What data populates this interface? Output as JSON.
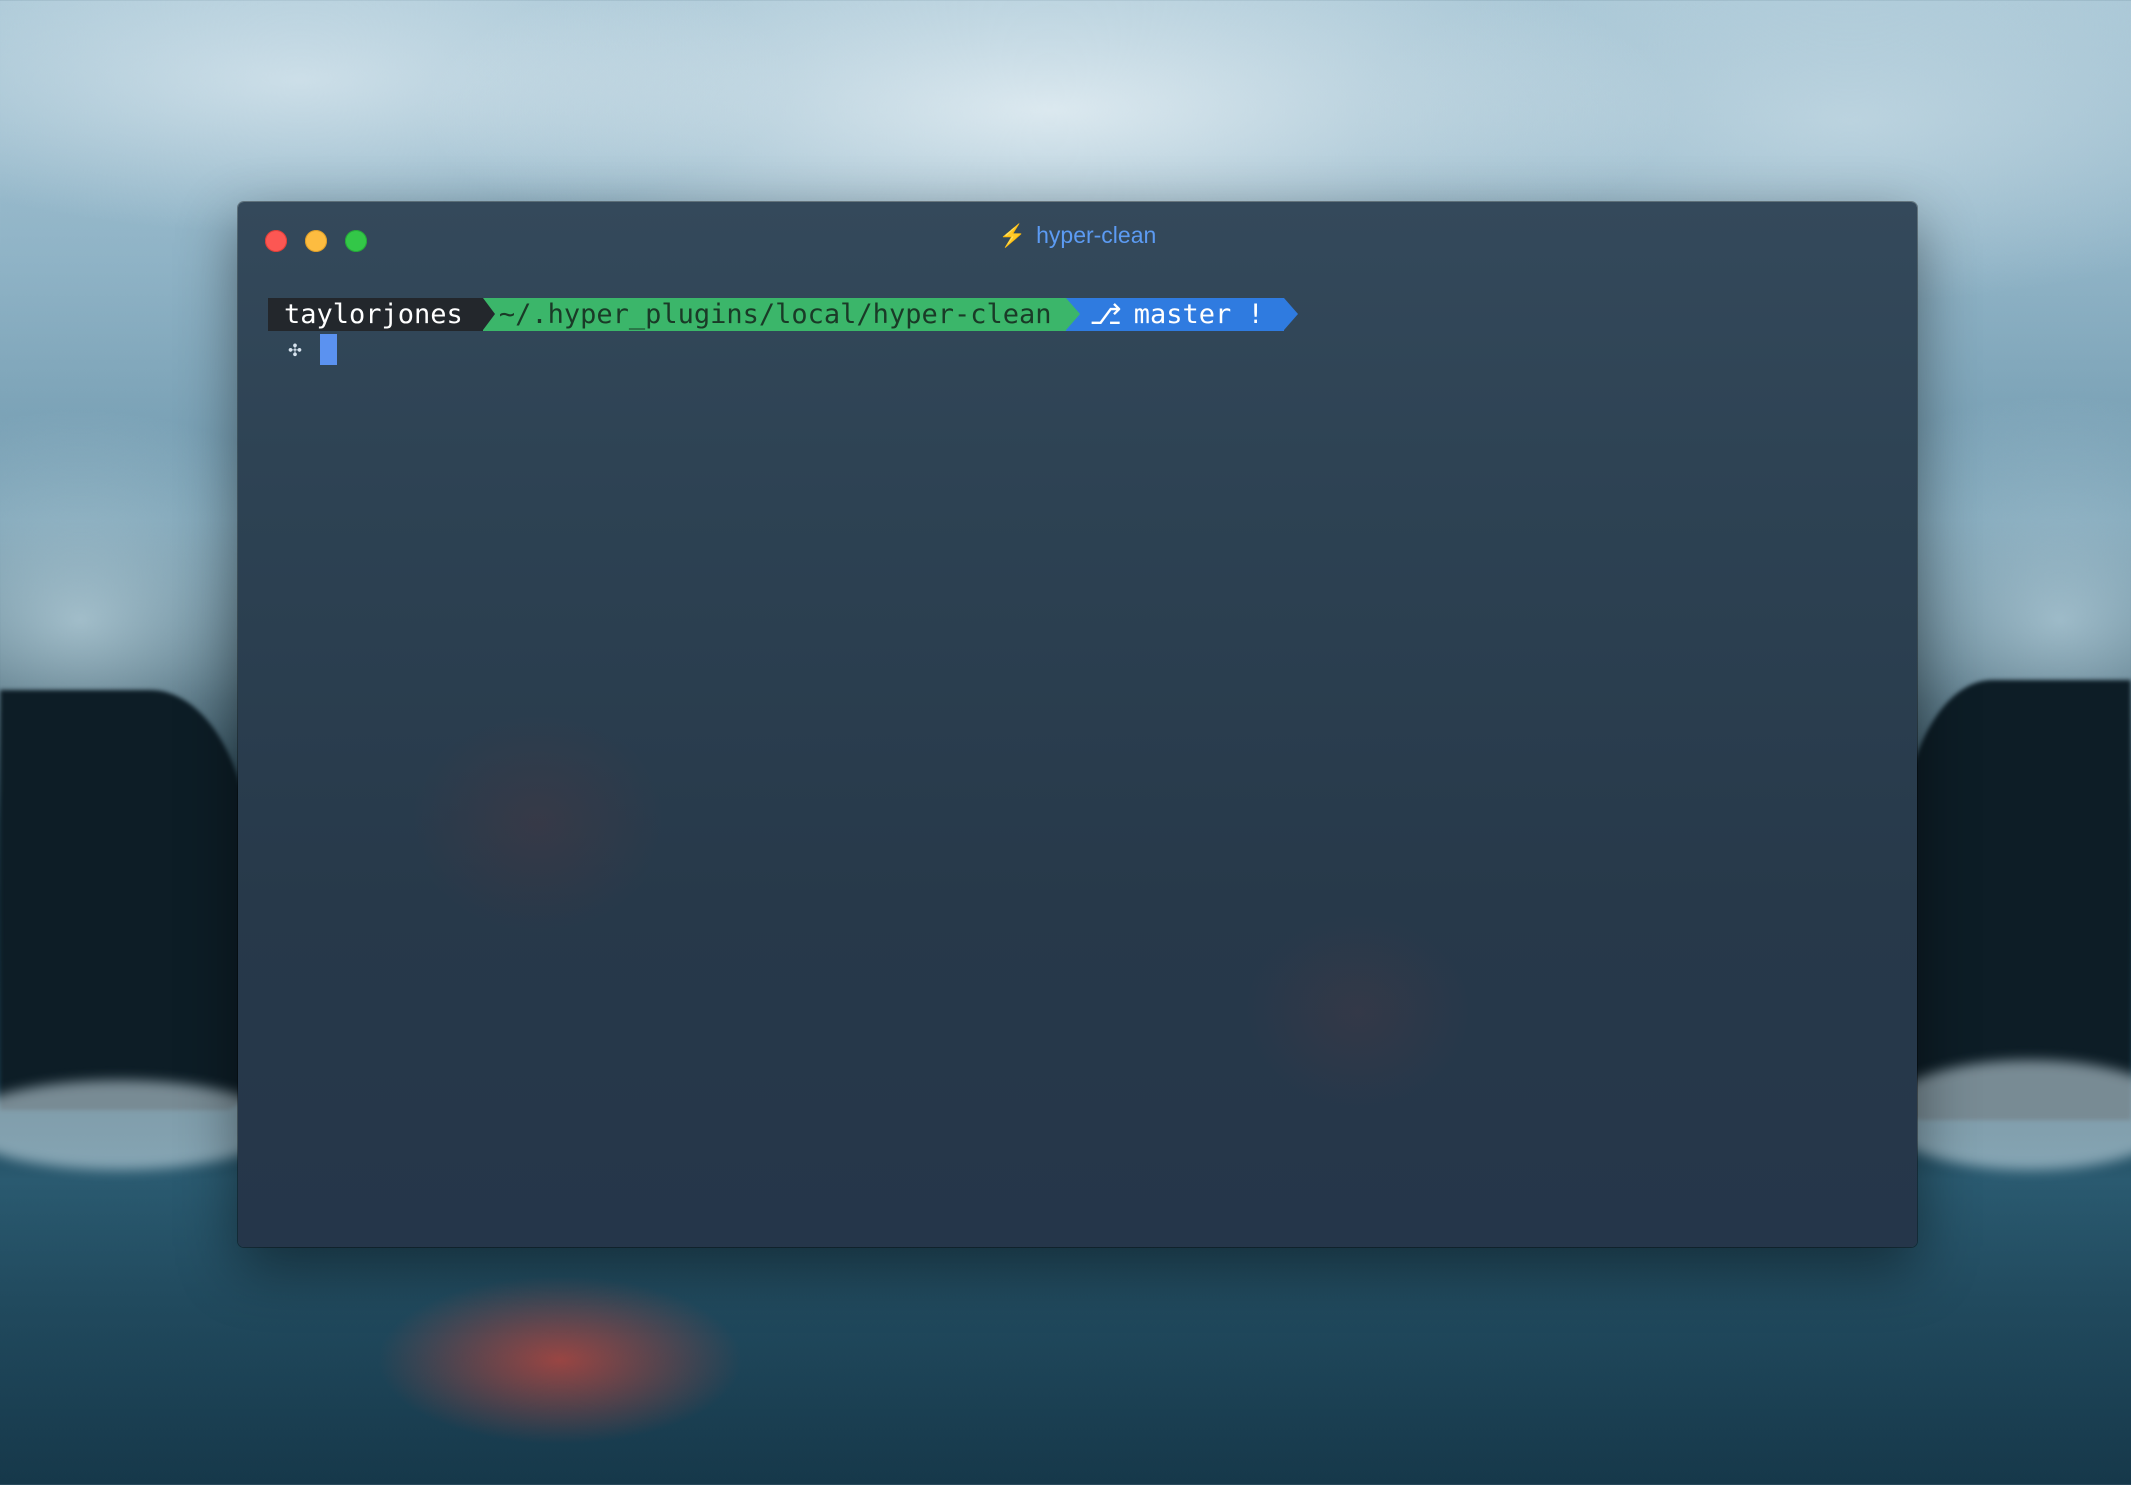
{
  "window": {
    "title": "hyper-clean",
    "title_icon": "lightning-bolt-icon",
    "controls": [
      "close",
      "minimize",
      "maximize"
    ]
  },
  "terminal": {
    "prompt": {
      "user": "taylorjones",
      "path": "~/.hyper_plugins/local/hyper-clean",
      "git_icon": "git-branch-icon",
      "git_branch": "master !"
    },
    "input_icon": "command-icon",
    "input_value": ""
  },
  "colors": {
    "user_segment_bg": "#23272c",
    "path_segment_bg": "#3bb66a",
    "git_segment_bg": "#2f7be0",
    "title_text": "#5c9bf3",
    "bolt": "#f6c343",
    "cursor": "#5b92f0",
    "close": "#fc5753",
    "minimize": "#fdbc40",
    "maximize": "#33c748"
  }
}
